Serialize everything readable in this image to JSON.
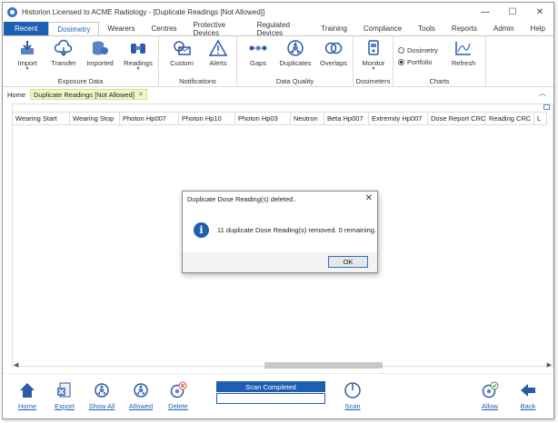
{
  "window": {
    "title": "Historion Licensed to ACME Radiology - [Duplicate Readings [Not Allowed]]",
    "controls": [
      "—",
      "☐",
      "✕"
    ]
  },
  "menu": {
    "recent": "Recent",
    "tabs": [
      "Dosimetry",
      "Wearers",
      "Centres",
      "Protective Devices",
      "Regulated Devices",
      "Training",
      "Compliance",
      "Tools",
      "Reports",
      "Admin",
      "Help"
    ],
    "active_tab": "Dosimetry"
  },
  "ribbon": {
    "exposure_data": {
      "label": "Exposure Data",
      "buttons": [
        "Import",
        "Transfer",
        "Imported",
        "Readings"
      ]
    },
    "notifications": {
      "label": "Notifications",
      "buttons": [
        "Custom",
        "Alerts"
      ]
    },
    "data_quality": {
      "label": "Data Quality",
      "buttons": [
        "Gaps",
        "Duplicates",
        "Overlaps"
      ]
    },
    "dosimeters": {
      "label": "Dosimeters",
      "buttons": [
        "Monitor"
      ]
    },
    "charts": {
      "label": "Charts",
      "options": [
        "Dosimetry",
        "Portfolio"
      ],
      "selected": "Portfolio",
      "refresh": "Refresh"
    }
  },
  "doctabs": {
    "home": "Home",
    "current": "Duplicate Readings [Not Allowed]",
    "close": "✕"
  },
  "grid": {
    "columns": [
      "Wearing Start",
      "Wearing Stop",
      "Photon Hp007",
      "Photon Hp10",
      "Photon Hp03",
      "Neutron",
      "Beta Hp007",
      "Extremity Hp007",
      "Dose Report CRC",
      "Reading CRC",
      "L"
    ]
  },
  "dialog": {
    "title": "Duplicate Dose Reading(s) deleted..",
    "close": "✕",
    "icon": "i",
    "message": "11 duplicate Dose Reading(s) removed. 0 remaining.",
    "ok": "OK"
  },
  "bottom": {
    "buttons": [
      "Home",
      "Export",
      "Show All",
      "Allowed",
      "Delete"
    ],
    "scan_status": "Scan Completed",
    "scan_progress": 0,
    "scan": "Scan",
    "allow": "Allow",
    "back": "Back"
  },
  "colors": {
    "accent": "#1f5fb3",
    "tab_highlight": "#eef7c9",
    "ribbon_icon": "#5b82c4"
  }
}
